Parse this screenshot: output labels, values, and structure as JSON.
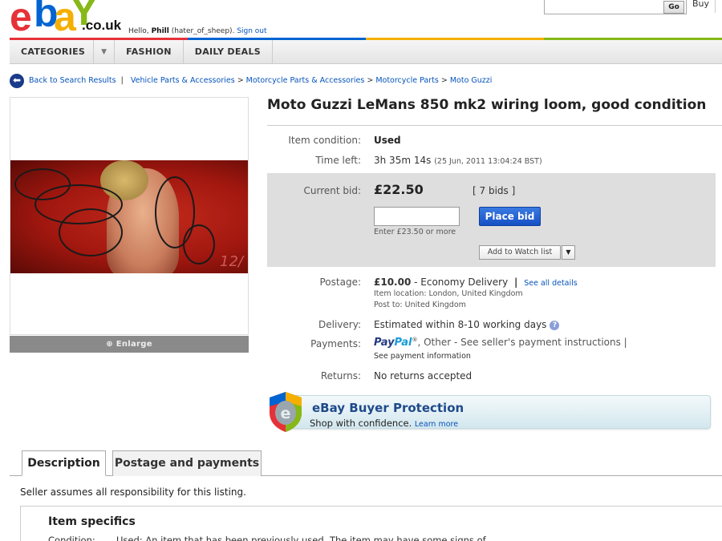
{
  "header": {
    "logo_tld": ".co.uk",
    "greeting_prefix": "Hello,",
    "user_name": "Phill",
    "user_handle": "(hater_of_sheep).",
    "sign_out": "Sign out",
    "go_label": "Go",
    "buy_label": "Buy"
  },
  "brand_colors": [
    "#e53238",
    "#0064d2",
    "#f5af02",
    "#86b817"
  ],
  "nav": {
    "categories": "CATEGORIES",
    "fashion": "FASHION",
    "daily_deals": "DAILY DEALS"
  },
  "breadcrumb": {
    "back": "Back to Search Results",
    "path": [
      "Vehicle Parts & Accessories",
      "Motorcycle Parts & Accessories",
      "Motorcycle Parts",
      "Moto Guzzi"
    ]
  },
  "image_panel": {
    "enlarge": "Enlarge"
  },
  "item": {
    "title": "Moto Guzzi LeMans 850 mk2 wiring loom, good condition",
    "condition_label": "Item condition:",
    "condition_value": "Used",
    "time_label": "Time left:",
    "time_value": "3h 35m 14s",
    "time_end": "(25 Jun, 2011 13:04:24 BST)"
  },
  "bid": {
    "label": "Current bid:",
    "amount": "£22.50",
    "bids_link": "[ 7 bids ]",
    "input_hint": "Enter £23.50 or more",
    "place_bid": "Place bid",
    "watch_list": "Add to Watch list"
  },
  "shipping": {
    "postage_label": "Postage:",
    "postage_price": "£10.00",
    "postage_method": "- Economy Delivery",
    "postage_sep": "|",
    "see_all": "See all details",
    "location": "Item location: London, United Kingdom",
    "post_to": "Post to: United Kingdom",
    "delivery_label": "Delivery:",
    "delivery_value": "Estimated within 8-10 working days",
    "payments_label": "Payments:",
    "paypal_1": "Pay",
    "paypal_2": "Pal",
    "paypal_mark": "®",
    "payments_rest": ", Other - See seller's payment instructions |",
    "payment_info": "See payment information",
    "returns_label": "Returns:",
    "returns_value": "No returns accepted"
  },
  "protection": {
    "title": "eBay Buyer Protection",
    "subtitle": "Shop with confidence.",
    "learn_more": "Learn more"
  },
  "tabs": {
    "description": "Description",
    "postage": "Postage and payments"
  },
  "description": {
    "seller_note": "Seller assumes all responsibility for this listing.",
    "specs_title": "Item specifics",
    "condition_label": "Condition:",
    "condition_text": "Used: An item that has been previously used. The item may have some signs of"
  }
}
